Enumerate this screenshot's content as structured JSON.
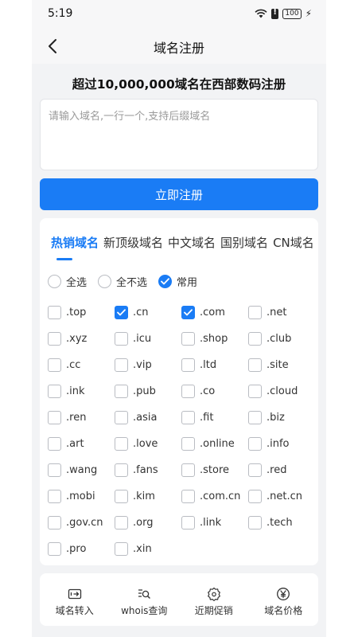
{
  "status": {
    "time": "5:19",
    "battery": "100"
  },
  "header": {
    "title": "域名注册"
  },
  "headline": "超过10,000,000域名在西部数码注册",
  "input": {
    "placeholder": "请输入域名,一行一个,支持后缀域名",
    "value": ""
  },
  "register_button": "立即注册",
  "tabs": [
    {
      "label": "热销域名",
      "active": true
    },
    {
      "label": "新顶级域名",
      "active": false
    },
    {
      "label": "中文域名",
      "active": false
    },
    {
      "label": "国别域名",
      "active": false
    },
    {
      "label": "CN域名",
      "active": false
    }
  ],
  "select_options": [
    {
      "label": "全选",
      "selected": false
    },
    {
      "label": "全不选",
      "selected": false
    },
    {
      "label": "常用",
      "selected": true
    }
  ],
  "suffixes": [
    {
      "label": ".top",
      "checked": false
    },
    {
      "label": ".cn",
      "checked": true
    },
    {
      "label": ".com",
      "checked": true
    },
    {
      "label": ".net",
      "checked": false
    },
    {
      "label": ".xyz",
      "checked": false
    },
    {
      "label": ".icu",
      "checked": false
    },
    {
      "label": ".shop",
      "checked": false
    },
    {
      "label": ".club",
      "checked": false
    },
    {
      "label": ".cc",
      "checked": false
    },
    {
      "label": ".vip",
      "checked": false
    },
    {
      "label": ".ltd",
      "checked": false
    },
    {
      "label": ".site",
      "checked": false
    },
    {
      "label": ".ink",
      "checked": false
    },
    {
      "label": ".pub",
      "checked": false
    },
    {
      "label": ".co",
      "checked": false
    },
    {
      "label": ".cloud",
      "checked": false
    },
    {
      "label": ".ren",
      "checked": false
    },
    {
      "label": ".asia",
      "checked": false
    },
    {
      "label": ".fit",
      "checked": false
    },
    {
      "label": ".biz",
      "checked": false
    },
    {
      "label": ".art",
      "checked": false
    },
    {
      "label": ".love",
      "checked": false
    },
    {
      "label": ".online",
      "checked": false
    },
    {
      "label": ".info",
      "checked": false
    },
    {
      "label": ".wang",
      "checked": false
    },
    {
      "label": ".fans",
      "checked": false
    },
    {
      "label": ".store",
      "checked": false
    },
    {
      "label": ".red",
      "checked": false
    },
    {
      "label": ".mobi",
      "checked": false
    },
    {
      "label": ".kim",
      "checked": false
    },
    {
      "label": ".com.cn",
      "checked": false
    },
    {
      "label": ".net.cn",
      "checked": false
    },
    {
      "label": ".gov.cn",
      "checked": false
    },
    {
      "label": ".org",
      "checked": false
    },
    {
      "label": ".link",
      "checked": false
    },
    {
      "label": ".tech",
      "checked": false
    },
    {
      "label": ".pro",
      "checked": false
    },
    {
      "label": ".xin",
      "checked": false
    }
  ],
  "bottom_nav": [
    {
      "label": "域名转入",
      "icon": "transfer-icon"
    },
    {
      "label": "whois查询",
      "icon": "whois-search-icon"
    },
    {
      "label": "近期促销",
      "icon": "promotion-badge-icon"
    },
    {
      "label": "域名价格",
      "icon": "price-yen-icon"
    }
  ],
  "colors": {
    "accent": "#1a7cf5",
    "background": "#f2f3f5"
  }
}
